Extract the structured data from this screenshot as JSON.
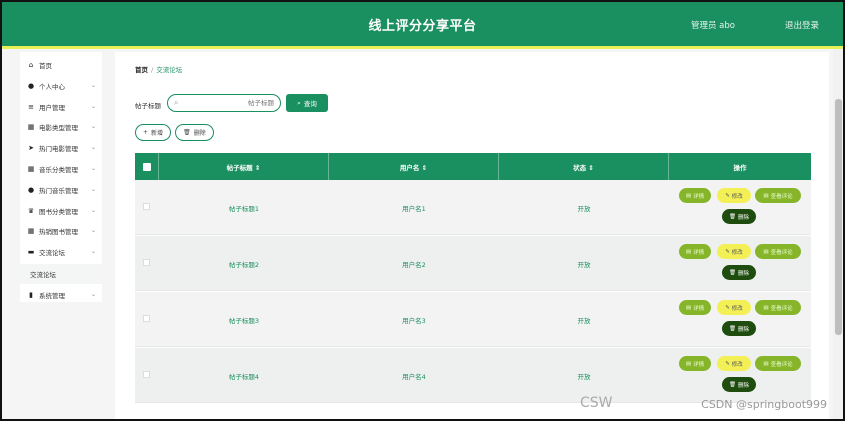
{
  "header": {
    "title": "线上评分分享平台",
    "user": "管理员 abo",
    "logout": "退出登录"
  },
  "sidebar": {
    "items": [
      {
        "label": "首页",
        "icon": "home-icon",
        "glyph": "⌂",
        "chevron": false
      },
      {
        "label": "个人中心",
        "icon": "user-icon",
        "glyph": "●",
        "chevron": true
      },
      {
        "label": "用户管理",
        "icon": "sliders-icon",
        "glyph": "≡",
        "chevron": true
      },
      {
        "label": "电影类型管理",
        "icon": "grid-icon",
        "glyph": "▦",
        "chevron": true
      },
      {
        "label": "热门电影管理",
        "icon": "send-icon",
        "glyph": "➤",
        "chevron": true
      },
      {
        "label": "音乐分类管理",
        "icon": "grid-icon",
        "glyph": "▦",
        "chevron": true
      },
      {
        "label": "热门音乐管理",
        "icon": "location-icon",
        "glyph": "●",
        "chevron": true
      },
      {
        "label": "图书分类管理",
        "icon": "trophy-icon",
        "glyph": "♛",
        "chevron": true
      },
      {
        "label": "热销图书管理",
        "icon": "grid-icon",
        "glyph": "▦",
        "chevron": true
      },
      {
        "label": "交流论坛",
        "icon": "chat-icon",
        "glyph": "▬",
        "chevron": true
      }
    ],
    "sub_item": "交流论坛",
    "last_item": {
      "label": "系统管理",
      "icon": "bar-chart-icon",
      "glyph": "▮"
    }
  },
  "breadcrumb": {
    "home": "首页",
    "separator": "/",
    "current": "交流论坛"
  },
  "search": {
    "label": "帖子标题",
    "placeholder": "帖子标题",
    "button": "查询"
  },
  "actions": {
    "add": "新增",
    "delete": "删除"
  },
  "table": {
    "headers": [
      "帖子标题 ⇕",
      "用户名 ⇕",
      "状态 ⇕",
      "操作"
    ],
    "rows": [
      {
        "title": "帖子标题1",
        "user": "用户名1",
        "status": "开放"
      },
      {
        "title": "帖子标题2",
        "user": "用户名2",
        "status": "开放"
      },
      {
        "title": "帖子标题3",
        "user": "用户名3",
        "status": "开放"
      },
      {
        "title": "帖子标题4",
        "user": "用户名4",
        "status": "开放"
      }
    ],
    "ops": {
      "detail": "详情",
      "edit": "修改",
      "comment": "查看评论",
      "delete": "删除"
    }
  },
  "watermark": "CSDN @springboot999",
  "watermark_overlay": "CSW",
  "colors": {
    "primary": "#1a8f60",
    "accent": "#e8ef57",
    "detail": "#86b52a",
    "edit": "#f3f056",
    "delete": "#1e4d0f"
  }
}
